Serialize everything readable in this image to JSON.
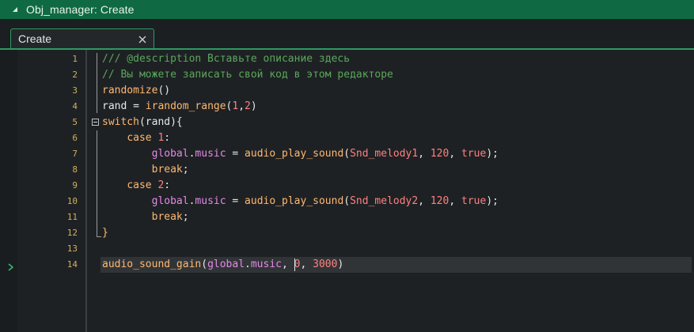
{
  "window": {
    "title": "Obj_manager: Create",
    "accent_color": "#0f6a43"
  },
  "tabs": [
    {
      "label": "Create",
      "active": true
    }
  ],
  "editor": {
    "current_line": 14,
    "lines": [
      {
        "num": "1",
        "tokens": [
          {
            "t": "/// @description Вставьте описание здесь",
            "k": "comment"
          }
        ]
      },
      {
        "num": "2",
        "tokens": [
          {
            "t": "// Вы можете записать свой код в этом редакторе",
            "k": "comment"
          }
        ]
      },
      {
        "num": "3",
        "tokens": [
          {
            "t": "randomize",
            "k": "func"
          },
          {
            "t": "()",
            "k": "punct"
          }
        ]
      },
      {
        "num": "4",
        "tokens": [
          {
            "t": "rand",
            "k": "text"
          },
          {
            "t": " = ",
            "k": "punct"
          },
          {
            "t": "irandom_range",
            "k": "func"
          },
          {
            "t": "(",
            "k": "punct"
          },
          {
            "t": "1",
            "k": "number"
          },
          {
            "t": ",",
            "k": "punct"
          },
          {
            "t": "2",
            "k": "number"
          },
          {
            "t": ")",
            "k": "punct"
          }
        ]
      },
      {
        "num": "5",
        "tokens": [
          {
            "t": "switch",
            "k": "keyword"
          },
          {
            "t": "(rand){",
            "k": "punct"
          }
        ]
      },
      {
        "num": "6",
        "tokens": [
          {
            "t": "    ",
            "k": "punct"
          },
          {
            "t": "case",
            "k": "keyword"
          },
          {
            "t": " ",
            "k": "punct"
          },
          {
            "t": "1",
            "k": "number"
          },
          {
            "t": ":",
            "k": "punct"
          }
        ]
      },
      {
        "num": "7",
        "tokens": [
          {
            "t": "        ",
            "k": "punct"
          },
          {
            "t": "global",
            "k": "global"
          },
          {
            "t": ".",
            "k": "punct"
          },
          {
            "t": "music",
            "k": "member"
          },
          {
            "t": " = ",
            "k": "punct"
          },
          {
            "t": "audio_play_sound",
            "k": "func"
          },
          {
            "t": "(",
            "k": "punct"
          },
          {
            "t": "Snd_melody1",
            "k": "res"
          },
          {
            "t": ", ",
            "k": "punct"
          },
          {
            "t": "120",
            "k": "number"
          },
          {
            "t": ", ",
            "k": "punct"
          },
          {
            "t": "true",
            "k": "bool"
          },
          {
            "t": ");",
            "k": "punct"
          }
        ]
      },
      {
        "num": "8",
        "tokens": [
          {
            "t": "        ",
            "k": "punct"
          },
          {
            "t": "break",
            "k": "keyword"
          },
          {
            "t": ";",
            "k": "punct"
          }
        ]
      },
      {
        "num": "9",
        "tokens": [
          {
            "t": "    ",
            "k": "punct"
          },
          {
            "t": "case",
            "k": "keyword"
          },
          {
            "t": " ",
            "k": "punct"
          },
          {
            "t": "2",
            "k": "number"
          },
          {
            "t": ":",
            "k": "punct"
          }
        ]
      },
      {
        "num": "10",
        "tokens": [
          {
            "t": "        ",
            "k": "punct"
          },
          {
            "t": "global",
            "k": "global"
          },
          {
            "t": ".",
            "k": "punct"
          },
          {
            "t": "music",
            "k": "member"
          },
          {
            "t": " = ",
            "k": "punct"
          },
          {
            "t": "audio_play_sound",
            "k": "func"
          },
          {
            "t": "(",
            "k": "punct"
          },
          {
            "t": "Snd_melody2",
            "k": "res"
          },
          {
            "t": ", ",
            "k": "punct"
          },
          {
            "t": "120",
            "k": "number"
          },
          {
            "t": ", ",
            "k": "punct"
          },
          {
            "t": "true",
            "k": "bool"
          },
          {
            "t": ");",
            "k": "punct"
          }
        ]
      },
      {
        "num": "11",
        "tokens": [
          {
            "t": "        ",
            "k": "punct"
          },
          {
            "t": "break",
            "k": "keyword"
          },
          {
            "t": ";",
            "k": "punct"
          }
        ]
      },
      {
        "num": "12",
        "tokens": [
          {
            "t": "}",
            "k": "keyword"
          }
        ]
      },
      {
        "num": "13",
        "tokens": []
      },
      {
        "num": "14",
        "tokens": [
          {
            "t": "audio_sound_gain",
            "k": "func"
          },
          {
            "t": "(",
            "k": "punct"
          },
          {
            "t": "global",
            "k": "global"
          },
          {
            "t": ".",
            "k": "punct"
          },
          {
            "t": "music",
            "k": "member"
          },
          {
            "t": ", ",
            "k": "punct"
          },
          {
            "t": "0",
            "k": "number"
          },
          {
            "t": ", ",
            "k": "punct"
          },
          {
            "t": "3000",
            "k": "number"
          },
          {
            "t": ")",
            "k": "punct"
          }
        ]
      }
    ]
  },
  "icons": {
    "collapse": "collapse-triangle-icon",
    "close": "close-icon",
    "fold": "fold-minus-icon",
    "current_line": "current-line-arrow-icon"
  }
}
